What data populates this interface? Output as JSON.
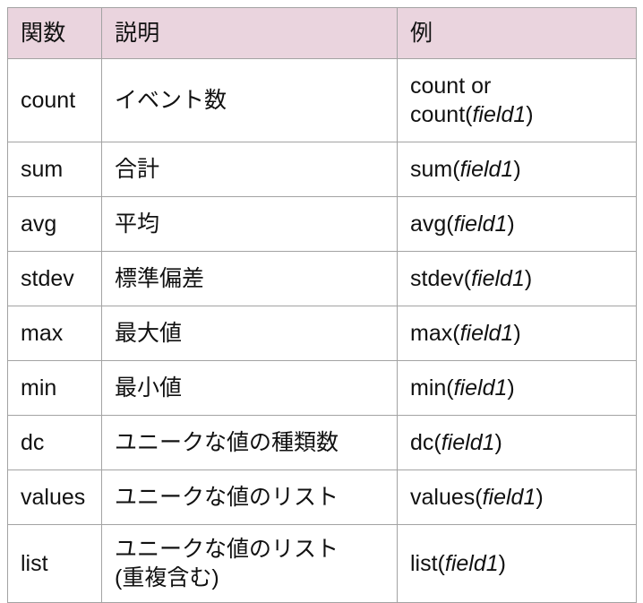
{
  "table": {
    "headers": {
      "function": "関数",
      "description": "説明",
      "example": "例"
    },
    "rows": [
      {
        "function": "count",
        "description_lines": [
          "イベント数"
        ],
        "example_lines": [
          {
            "prefix": "count or",
            "arg": "",
            "suffix": ""
          },
          {
            "prefix": "count(",
            "arg": "field1",
            "suffix": ")"
          }
        ]
      },
      {
        "function": "sum",
        "description_lines": [
          "合計"
        ],
        "example_lines": [
          {
            "prefix": "sum(",
            "arg": "field1",
            "suffix": ")"
          }
        ]
      },
      {
        "function": "avg",
        "description_lines": [
          "平均"
        ],
        "example_lines": [
          {
            "prefix": "avg(",
            "arg": "field1",
            "suffix": ")"
          }
        ]
      },
      {
        "function": "stdev",
        "description_lines": [
          "標準偏差"
        ],
        "example_lines": [
          {
            "prefix": "stdev(",
            "arg": "field1",
            "suffix": ")"
          }
        ]
      },
      {
        "function": "max",
        "description_lines": [
          "最大値"
        ],
        "example_lines": [
          {
            "prefix": "max(",
            "arg": "field1",
            "suffix": ")"
          }
        ]
      },
      {
        "function": "min",
        "description_lines": [
          "最小値"
        ],
        "example_lines": [
          {
            "prefix": "min(",
            "arg": "field1",
            "suffix": ")"
          }
        ]
      },
      {
        "function": "dc",
        "description_lines": [
          "ユニークな値の種類数"
        ],
        "example_lines": [
          {
            "prefix": "dc(",
            "arg": "field1",
            "suffix": ")"
          }
        ]
      },
      {
        "function": "values",
        "description_lines": [
          "ユニークな値のリスト"
        ],
        "example_lines": [
          {
            "prefix": "values(",
            "arg": "field1",
            "suffix": ")"
          }
        ]
      },
      {
        "function": "list",
        "description_lines": [
          "ユニークな値のリスト",
          "(重複含む)"
        ],
        "example_lines": [
          {
            "prefix": "list(",
            "arg": "field1",
            "suffix": ")"
          }
        ]
      }
    ]
  },
  "colors": {
    "header_background": "#ead4de",
    "cell_background": "#ffffff",
    "border": "#a3a3a3",
    "text": "#111111",
    "page_background": "#ffffff"
  }
}
